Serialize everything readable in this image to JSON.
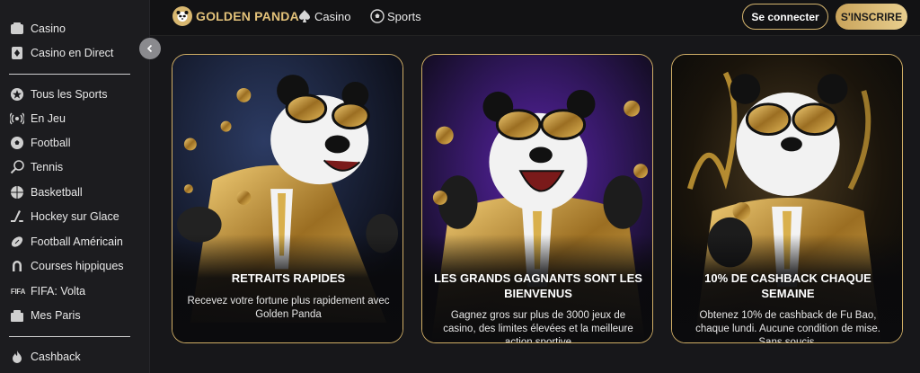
{
  "sidebar": {
    "items": [
      {
        "label": "Casino",
        "icon": "casino-icon"
      },
      {
        "label": "Casino en Direct",
        "icon": "live-casino-icon"
      },
      {
        "label": "Tous les Sports",
        "icon": "star-ball-icon"
      },
      {
        "label": "En Jeu",
        "icon": "live-broadcast-icon"
      },
      {
        "label": "Football",
        "icon": "soccer-ball-icon"
      },
      {
        "label": "Tennis",
        "icon": "tennis-icon"
      },
      {
        "label": "Basketball",
        "icon": "basketball-icon"
      },
      {
        "label": "Hockey sur Glace",
        "icon": "hockey-icon"
      },
      {
        "label": "Football Américain",
        "icon": "american-football-icon"
      },
      {
        "label": "Courses hippiques",
        "icon": "horseshoe-icon"
      },
      {
        "label": "FIFA: Volta",
        "icon_text": "FIFA"
      },
      {
        "label": "Mes Paris",
        "icon": "my-bets-icon"
      },
      {
        "label": "Cashback",
        "icon": "flame-icon"
      }
    ]
  },
  "header": {
    "logo_text": "GOLDEN PANDA",
    "nav": [
      {
        "label": "Casino",
        "icon": "spade-icon"
      },
      {
        "label": "Sports",
        "icon": "soccer-ball-icon"
      }
    ],
    "login_label": "Se connecter",
    "register_label": "S'INSCRIRE"
  },
  "cards": [
    {
      "title": "RETRAITS RAPIDES",
      "description": "Recevez votre fortune plus rapidement avec Golden Panda"
    },
    {
      "title": "LES GRANDS GAGNANTS SONT LES BIENVENUS",
      "description": "Gagnez gros sur plus de 3000 jeux de casino, des limites élevées et la meilleure action sportive"
    },
    {
      "title": "10% DE CASHBACK CHAQUE SEMAINE",
      "description": "Obtenez 10% de cashback de Fu Bao, chaque lundi. Aucune condition de mise. Sans soucis."
    }
  ],
  "colors": {
    "gold": "#d4b46e",
    "background": "#17171a",
    "sidebar": "#1c1c1f"
  }
}
